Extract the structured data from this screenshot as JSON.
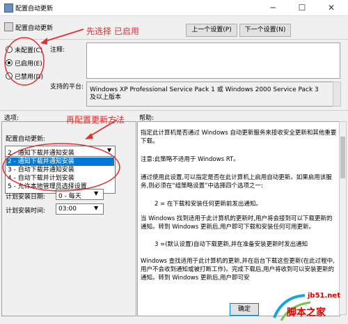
{
  "window": {
    "title": "配置自动更新",
    "min": "─",
    "max": "☐",
    "close": "✕"
  },
  "header": {
    "title": "配置自动更新",
    "prev": "上一个设置(P)",
    "next": "下一个设置(N)"
  },
  "radios": [
    {
      "label": "未配置(C)",
      "checked": false
    },
    {
      "label": "已启用(E)",
      "checked": true
    },
    {
      "label": "已禁用(D)",
      "checked": false
    }
  ],
  "note_label": "注释:",
  "platform_label": "支持的平台:",
  "platform_text": "Windows XP Professional Service Pack 1 或 Windows 2000 Service Pack 3 及以上版本",
  "options_label": "选项:",
  "help_label": "帮助:",
  "options": {
    "config_label": "配置自动更新:",
    "selected": "2 - 通知下载并通知安装",
    "dropdown": [
      "2 - 通知下载并通知安装",
      "3 - 自动下载并通知安装",
      "4 - 自动下载并计划安装",
      "5 - 允许本地管理员选择设置"
    ],
    "day_label": "计划安装日期:",
    "day_value": "0 - 每天",
    "time_label": "计划安装时间:",
    "time_value": "03:00"
  },
  "help": [
    "指定此计算机是否通过 Windows 自动更新服务来接收安全更新和其他重要下载。",
    "注意:此策略不适用于 Windows RT。",
    "通过使用此设置,可以指定是否在此计算机上启用自动更新。如果启用该服务,则必须在“组策略设置”中选择四个选项之一:",
    "2 = 在下载和安装任何更新前发出通知。",
    "当 Windows 找到适用于此计算机的更新时,用户将会接到可以下载更新的通知。转到 Windows 更新后,用户即可下载和安装任何可用更新。",
    "3 =(默认设置)自动下载更新,并在准备安装更新时发出通知",
    "Windows 查找适用于此计算机的更新,并在后台下载这些更新(在此过程中,用户不会收到通知或被打断工作)。完成下载后,用户将收到可以安装更新的通知。转到 Windows 更新后,用户即可安"
  ],
  "ok_label": "确定",
  "annotations": {
    "a1": "先选择 已启用",
    "a2": "再配置更新方法"
  },
  "watermark": {
    "url": "jb51.net",
    "name": "脚本之家"
  },
  "colors": {
    "annotation": "#e03030",
    "selection": "#0078d7",
    "watermark": "#dd0000"
  }
}
